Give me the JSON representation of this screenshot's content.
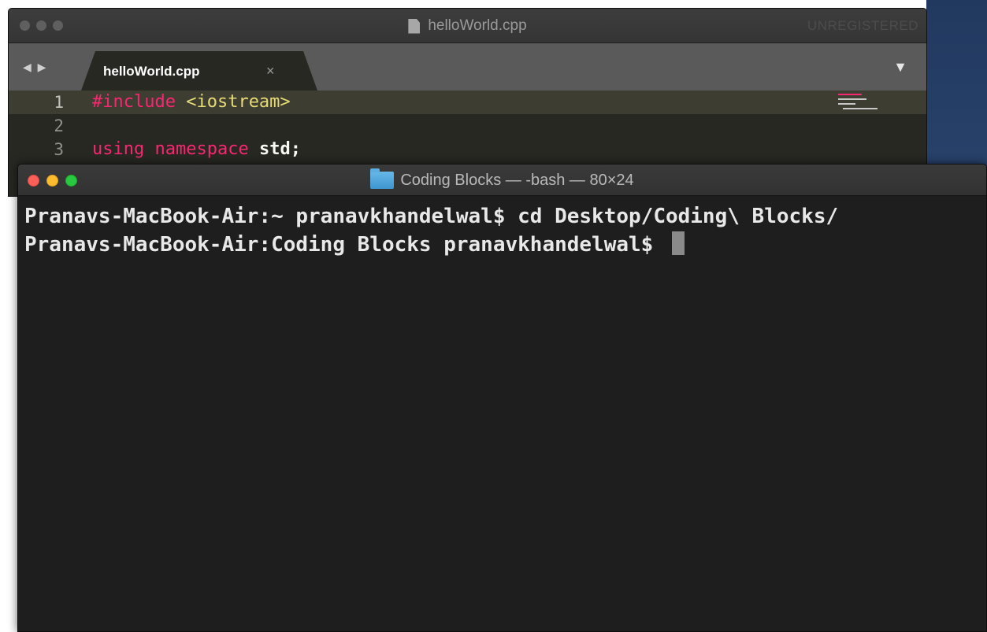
{
  "editor": {
    "window_title": "helloWorld.cpp",
    "license_status": "UNREGISTERED",
    "tab": {
      "label": "helloWorld.cpp",
      "close_glyph": "×"
    },
    "nav_glyph": "◀ ▶",
    "menu_glyph": "▼",
    "lines": [
      {
        "number": "1",
        "parts": [
          "#include",
          " ",
          "<iostream>"
        ]
      },
      {
        "number": "2",
        "parts": []
      },
      {
        "number": "3",
        "parts": [
          "using",
          " ",
          "namespace",
          " ",
          "std;"
        ]
      }
    ],
    "colors": {
      "background": "#272822",
      "keyword": "#f92672",
      "string": "#e6db74",
      "text": "#f8f8f2"
    }
  },
  "terminal": {
    "window_title": "Coding Blocks — -bash — 80×24",
    "lines": [
      "Pranavs-MacBook-Air:~ pranavkhandelwal$ cd Desktop/Coding\\ Blocks/",
      "Pranavs-MacBook-Air:Coding Blocks pranavkhandelwal$ "
    ],
    "colors": {
      "background": "#1e1e1e",
      "text": "#e8e8e8"
    }
  },
  "icons": {
    "editor_file": "document-icon",
    "terminal_folder": "folder-icon"
  }
}
